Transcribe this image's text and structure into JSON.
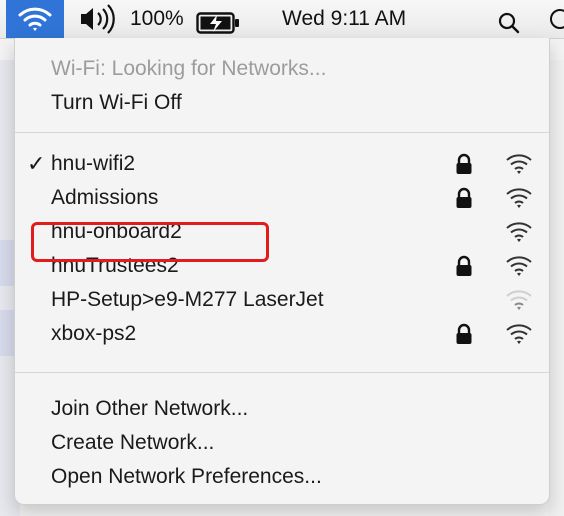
{
  "menubar": {
    "battery_percent": "100%",
    "clock": "Wed 9:11 AM",
    "icons": [
      "wifi-icon",
      "volume-icon",
      "battery-charging-icon",
      "search-icon"
    ]
  },
  "menu": {
    "status": "Wi-Fi: Looking for Networks...",
    "toggle": "Turn Wi-Fi Off",
    "networks": [
      {
        "name": "hnu-wifi2",
        "connected": true,
        "locked": true,
        "signal": "strong"
      },
      {
        "name": "Admissions",
        "connected": false,
        "locked": true,
        "signal": "strong"
      },
      {
        "name": "hnu-onboard2",
        "connected": false,
        "locked": false,
        "signal": "strong",
        "highlighted": true
      },
      {
        "name": "hnuTrustees2",
        "connected": false,
        "locked": true,
        "signal": "strong"
      },
      {
        "name": "HP-Setup>e9-M277 LaserJet",
        "connected": false,
        "locked": false,
        "signal": "weak"
      },
      {
        "name": "xbox-ps2",
        "connected": false,
        "locked": true,
        "signal": "strong"
      }
    ],
    "actions": {
      "join_other": "Join Other Network...",
      "create": "Create Network...",
      "open_prefs": "Open Network Preferences..."
    }
  },
  "colors": {
    "menubar_highlight": "#2f74d6",
    "annotation_red": "#e21c1c"
  }
}
